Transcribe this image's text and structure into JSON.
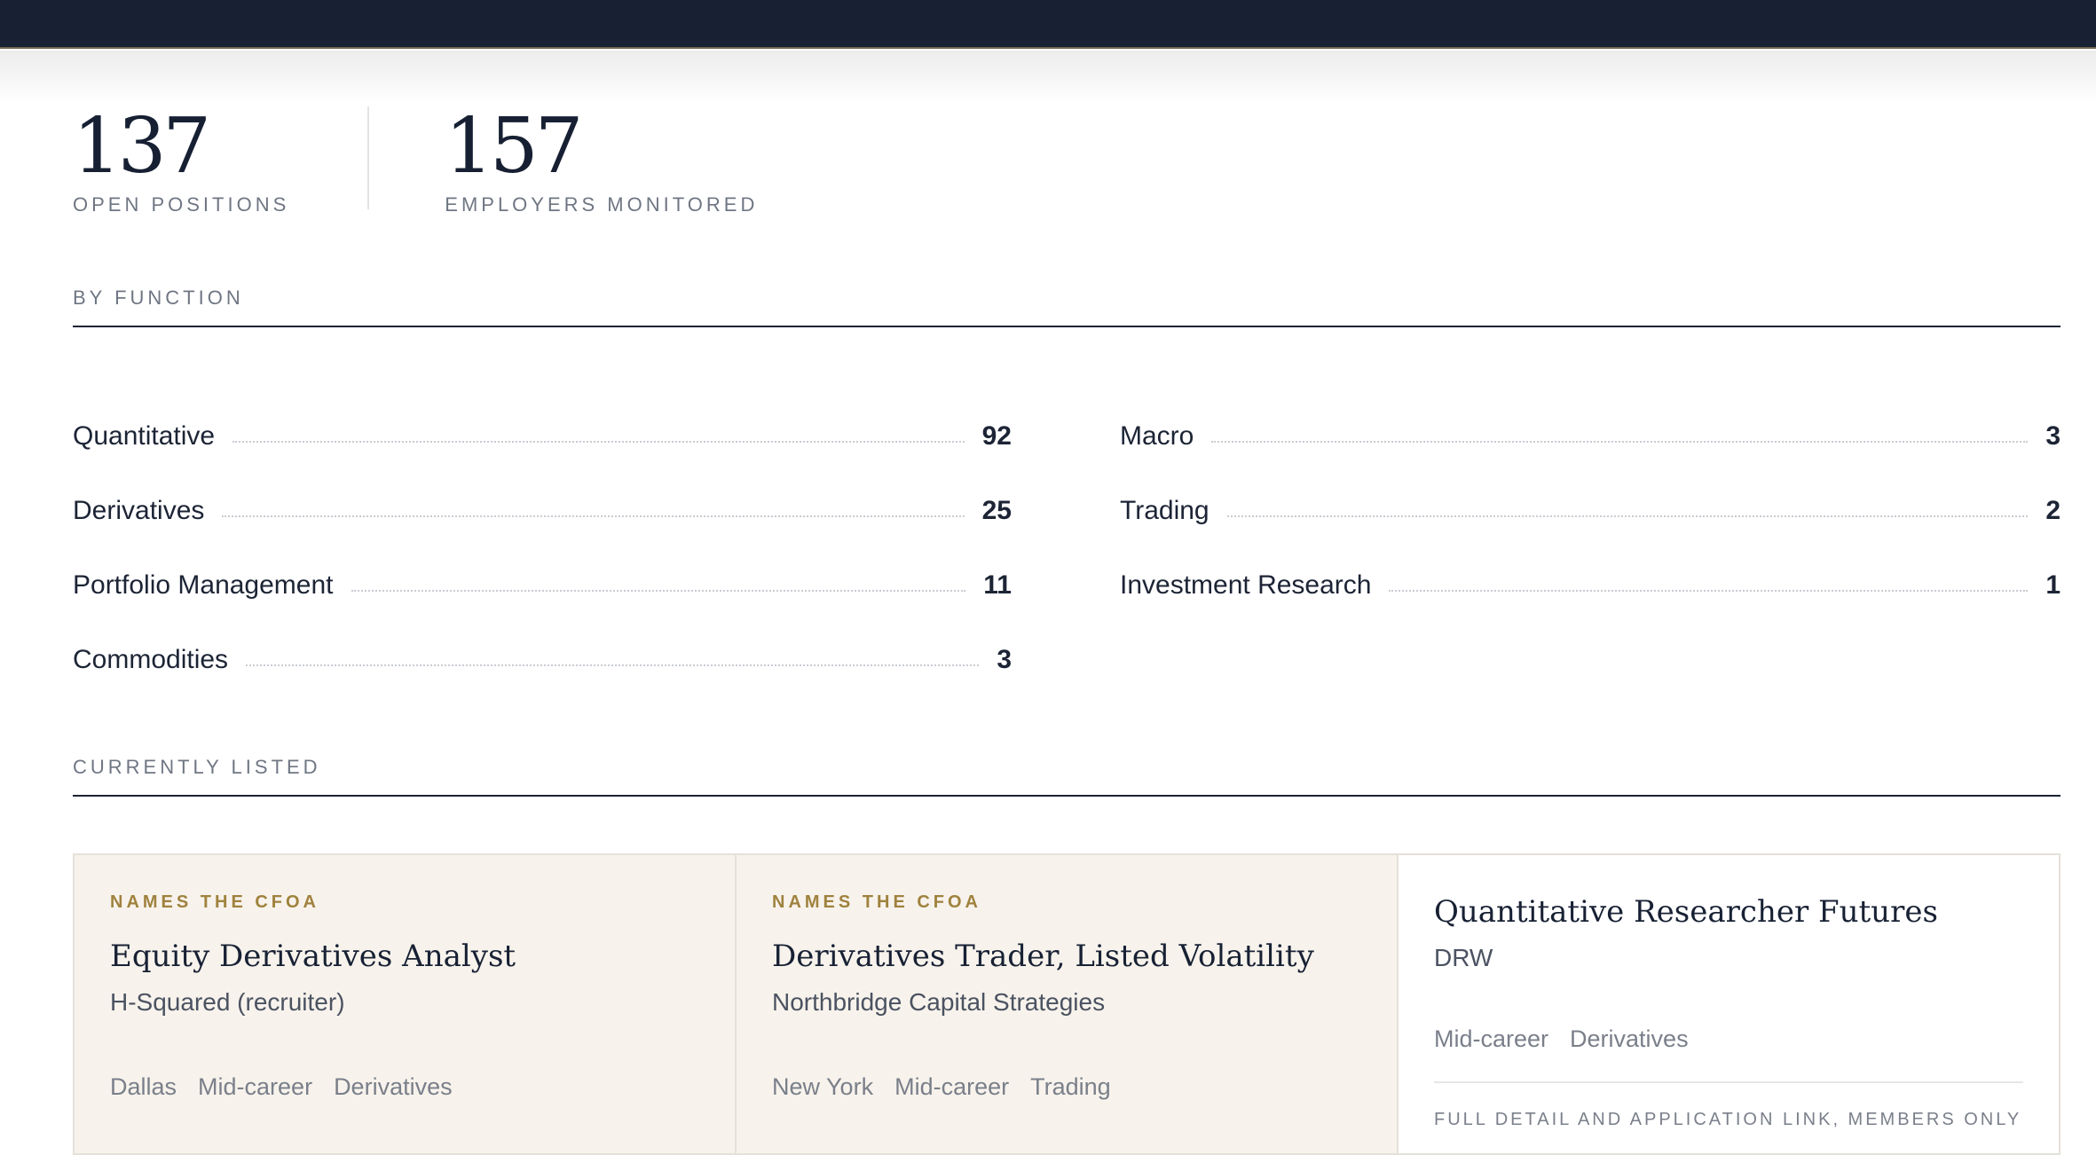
{
  "stats": {
    "open_positions": {
      "value": "137",
      "label": "OPEN POSITIONS"
    },
    "employers": {
      "value": "157",
      "label": "EMPLOYERS MONITORED"
    }
  },
  "by_function": {
    "heading": "BY FUNCTION",
    "left": [
      {
        "name": "Quantitative",
        "count": "92"
      },
      {
        "name": "Derivatives",
        "count": "25"
      },
      {
        "name": "Portfolio Management",
        "count": "11"
      },
      {
        "name": "Commodities",
        "count": "3"
      }
    ],
    "right": [
      {
        "name": "Macro",
        "count": "3"
      },
      {
        "name": "Trading",
        "count": "2"
      },
      {
        "name": "Investment Research",
        "count": "1"
      }
    ]
  },
  "currently_listed": {
    "heading": "CURRENTLY LISTED",
    "cards": [
      {
        "tag": "NAMES THE CFOA",
        "title": "Equity Derivatives Analyst",
        "company": "H-Squared (recruiter)",
        "meta": [
          "Dallas",
          "Mid-career",
          "Derivatives"
        ]
      },
      {
        "tag": "NAMES THE CFOA",
        "title": "Derivatives Trader, Listed Volatility",
        "company": "Northbridge Capital Strategies",
        "meta": [
          "New York",
          "Mid-career",
          "Trading"
        ]
      },
      {
        "tag": "",
        "title": "Quantitative Researcher Futures",
        "company": "DRW",
        "meta": [
          "Mid-career",
          "Derivatives"
        ],
        "note": "FULL DETAIL AND APPLICATION LINK, MEMBERS ONLY"
      }
    ]
  }
}
